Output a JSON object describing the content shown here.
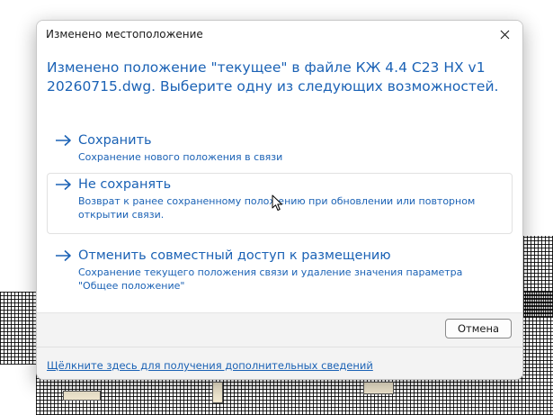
{
  "dialog": {
    "title": "Изменено местоположение",
    "instruction": "Изменено положение \"текущее\" в файле КЖ 4.4 С23 НХ v1 20260715.dwg. Выберите одну из следующих возможностей.",
    "options": [
      {
        "title": "Сохранить",
        "description": "Сохранение нового положения в связи"
      },
      {
        "title": "Не сохранять",
        "description": "Возврат к ранее сохраненному положению при обновлении или повторном открытии связи."
      },
      {
        "title": "Отменить совместный доступ к размещению",
        "description": "Сохранение текущего положения связи и удаление значения параметра \"Общее положение\""
      }
    ],
    "cancel_label": "Отмена",
    "more_info_link": "Щёлкните здесь для получения дополнительных сведений"
  },
  "colors": {
    "accent": "#1b62b5",
    "footer_bg": "#f3f3f3"
  },
  "icons": {
    "close": "close-icon",
    "arrow": "arrow-right-icon",
    "cursor": "mouse-cursor-icon"
  }
}
